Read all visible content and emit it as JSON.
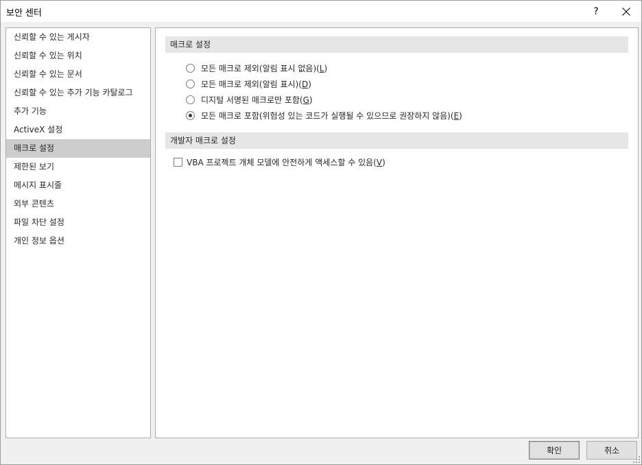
{
  "window": {
    "title": "보안 센터",
    "help": "?",
    "close_icon": "close-icon"
  },
  "sidebar": {
    "items": [
      {
        "label": "신뢰할 수 있는 게시자",
        "selected": false
      },
      {
        "label": "신뢰할 수 있는 위치",
        "selected": false
      },
      {
        "label": "신뢰할 수 있는 문서",
        "selected": false
      },
      {
        "label": "신뢰할 수 있는 추가 기능 카탈로그",
        "selected": false
      },
      {
        "label": "추가 기능",
        "selected": false
      },
      {
        "label": "ActiveX 설정",
        "selected": false
      },
      {
        "label": "매크로 설정",
        "selected": true
      },
      {
        "label": "제한된 보기",
        "selected": false
      },
      {
        "label": "메시지 표시줄",
        "selected": false
      },
      {
        "label": "외부 콘텐츠",
        "selected": false
      },
      {
        "label": "파일 차단 설정",
        "selected": false
      },
      {
        "label": "개인 정보 옵션",
        "selected": false
      }
    ]
  },
  "macro_settings": {
    "header": "매크로 설정",
    "options": [
      {
        "text": "모든 매크로 제외(알림 표시 없음)(",
        "key": "L",
        "suffix": ")",
        "checked": false
      },
      {
        "text": "모든 매크로 제외(알림 표시)(",
        "key": "D",
        "suffix": ")",
        "checked": false
      },
      {
        "text": "디지털 서명된 매크로만 포함(",
        "key": "G",
        "suffix": ")",
        "checked": false
      },
      {
        "text": "모든 매크로 포함(위험성 있는 코드가 실행될 수 있으므로 권장하지 않음)(",
        "key": "E",
        "suffix": ")",
        "checked": true
      }
    ]
  },
  "developer_settings": {
    "header": "개발자 매크로 설정",
    "vba_access": {
      "text": "VBA 프로젝트 개체 모델에 안전하게 액세스할 수 있음(",
      "key": "V",
      "suffix": ")",
      "checked": false
    }
  },
  "buttons": {
    "ok": "확인",
    "cancel": "취소"
  }
}
